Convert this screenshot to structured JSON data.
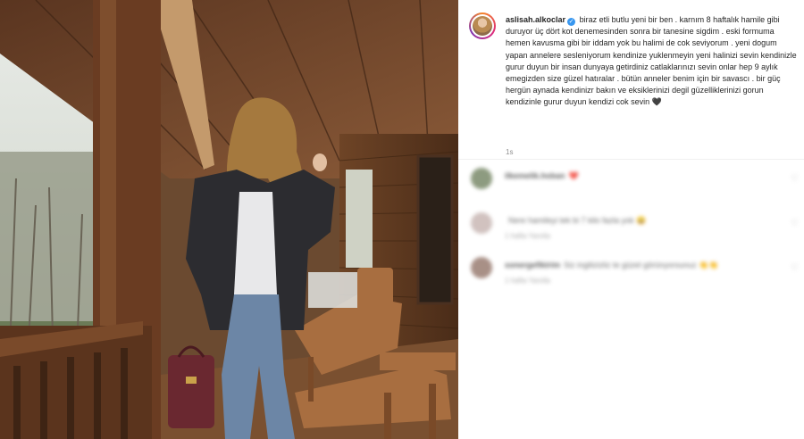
{
  "post": {
    "username": "aslisah.alkoclar",
    "verified": true,
    "caption": "biraz etli butlu yeni bir ben . karnım 8 haftalık hamile gibi duruyor üç dört kot denemesinden sonra bir tanesine sigdim . eski formuma hemen kavusma gibi bir iddam yok bu halimi de cok seviyorum . yeni dogum yapan annelere sesleniyorum kendinize yuklenmeyin yeni halinizi sevin kendinizle gurur duyun bir insan dunyaya getirdiniz catlaklarınızı sevin onlar hep 9 aylık emegizden size güzel hatıralar . bütün anneler benim için bir savascı . bir güç hergün aynada kendinizr bakın ve eksiklerinizi degil güzelliklerinizi gorun kendizinle gurur duyun kendizi cok sevin",
    "caption_emoji": "🖤",
    "time": "1s"
  },
  "comments": [
    {
      "username": "ilkemelik.hoban",
      "text": "❤️",
      "meta": "",
      "avatar_color": "#7a8a6a"
    },
    {
      "username": "",
      "text": "Nere hamileyi tek bi 7 kilo fazla yok 😄",
      "meta": "1 hafta   Yanıtla",
      "avatar_color": "#c9b8b5"
    },
    {
      "username": "sonergefikirim",
      "text": "Siz ingilizizliz te güzel görünyorsunuz 👏👏",
      "meta": "1 hafta   Yanıtla",
      "avatar_color": "#9a7d72"
    }
  ],
  "icons": {
    "verified": "verified-check-icon",
    "like": "heart-outline-icon"
  }
}
